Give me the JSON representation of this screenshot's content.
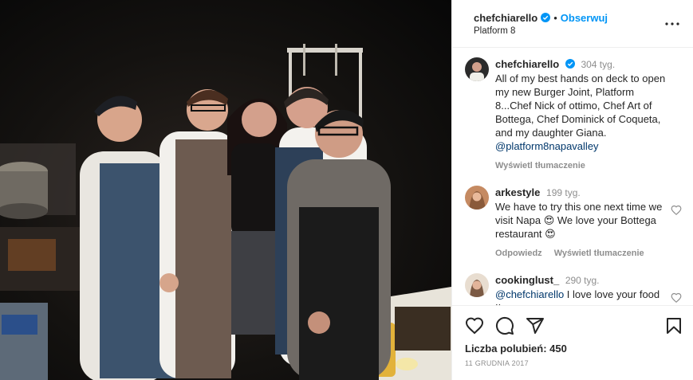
{
  "header": {
    "username": "chefchiarello",
    "separator": "•",
    "follow_label": "Obserwuj",
    "location": "Platform 8",
    "more_icon": "more-horizontal-icon"
  },
  "caption": {
    "username": "chefchiarello",
    "time": "304 tyg.",
    "text": "All of my best hands on deck to open my new Burger Joint, Platform 8...Chef Nick of ottimo, Chef Art of Bottega, Chef Dominick of Coqueta, and my daughter Giana.",
    "mention": "@platform8napavalley",
    "translate": "Wyświetl tłumaczenie"
  },
  "comments": [
    {
      "username": "arkestyle",
      "time": "199 tyg.",
      "text": "We have to try this one next time we visit Napa 😍 We love your Bottega restaurant 😍",
      "reply": "Odpowiedz",
      "translate": "Wyświetl tłumaczenie"
    },
    {
      "username": "cookinglust_",
      "time": "290 tyg.",
      "mention": "@chefchiarello",
      "text": " I love love your food !!"
    }
  ],
  "footer": {
    "likes": "Liczba polubień: 450",
    "date": "11 GRUDNIA 2017"
  },
  "colors": {
    "accent": "#0095f6",
    "verified": "#0095f6",
    "mention": "#00376b",
    "muted": "#8e8e8e"
  }
}
